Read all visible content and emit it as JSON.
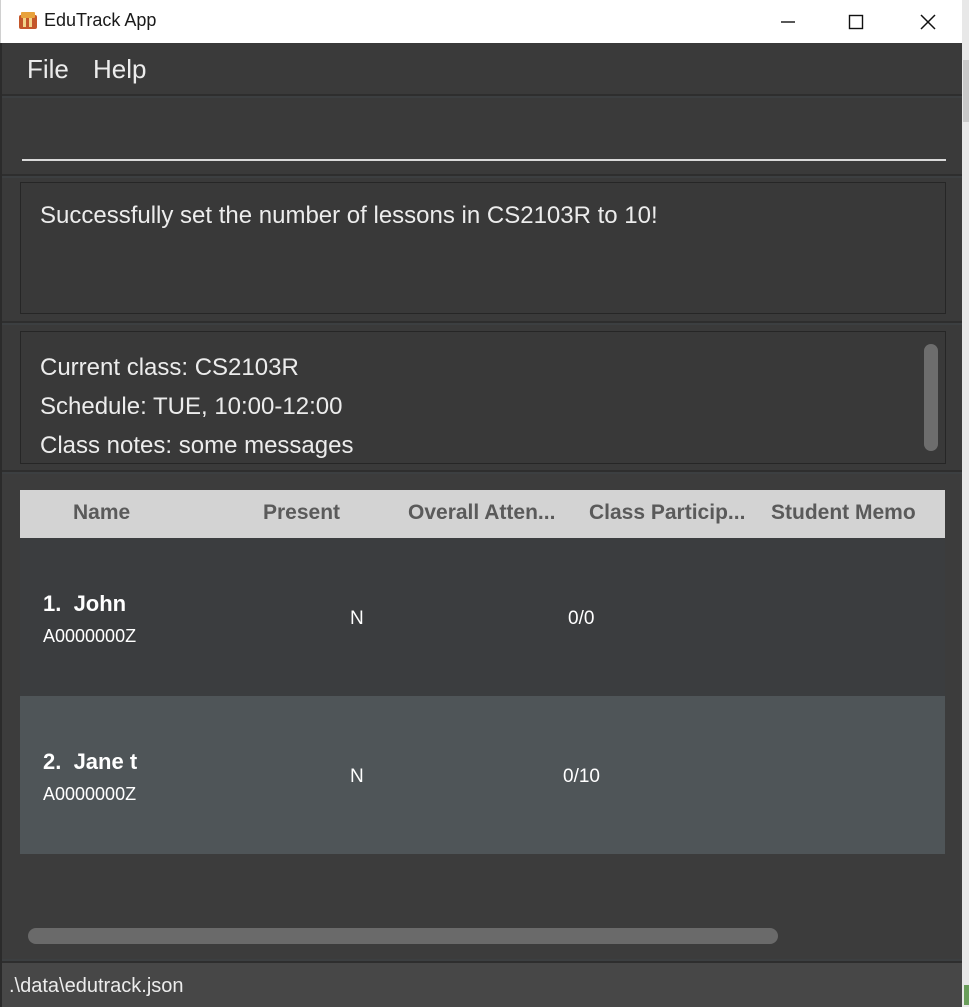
{
  "window": {
    "title": "EduTrack App"
  },
  "menu": {
    "file": "File",
    "help": "Help"
  },
  "command": {
    "value": "",
    "placeholder": ""
  },
  "result": {
    "message": "Successfully set the number of lessons in CS2103R to 10!"
  },
  "class_info": {
    "current_class": "Current class: CS2103R",
    "schedule": "Schedule: TUE, 10:00-12:00",
    "notes": "Class notes: some messages"
  },
  "table": {
    "columns": [
      "Name",
      "Present",
      "Overall Atten...",
      "Class Particip...",
      "Student Memo"
    ],
    "rows": [
      {
        "name": "1.  John",
        "id": "A0000000Z",
        "present": "N",
        "attendance": "0/0",
        "participation": "",
        "memo": ""
      },
      {
        "name": "2.  Jane t",
        "id": "A0000000Z",
        "present": "N",
        "attendance": "0/10",
        "participation": "",
        "memo": ""
      }
    ]
  },
  "status": {
    "file_path": ".\\data\\edutrack.json"
  },
  "icons": {
    "app": "edutrack-app-icon",
    "minimize": "minimize-icon",
    "maximize": "maximize-icon",
    "close": "close-icon"
  },
  "colors": {
    "background": "#3c3f41",
    "header_bg": "#d3d3d3",
    "selected_row": "#4f5558"
  }
}
